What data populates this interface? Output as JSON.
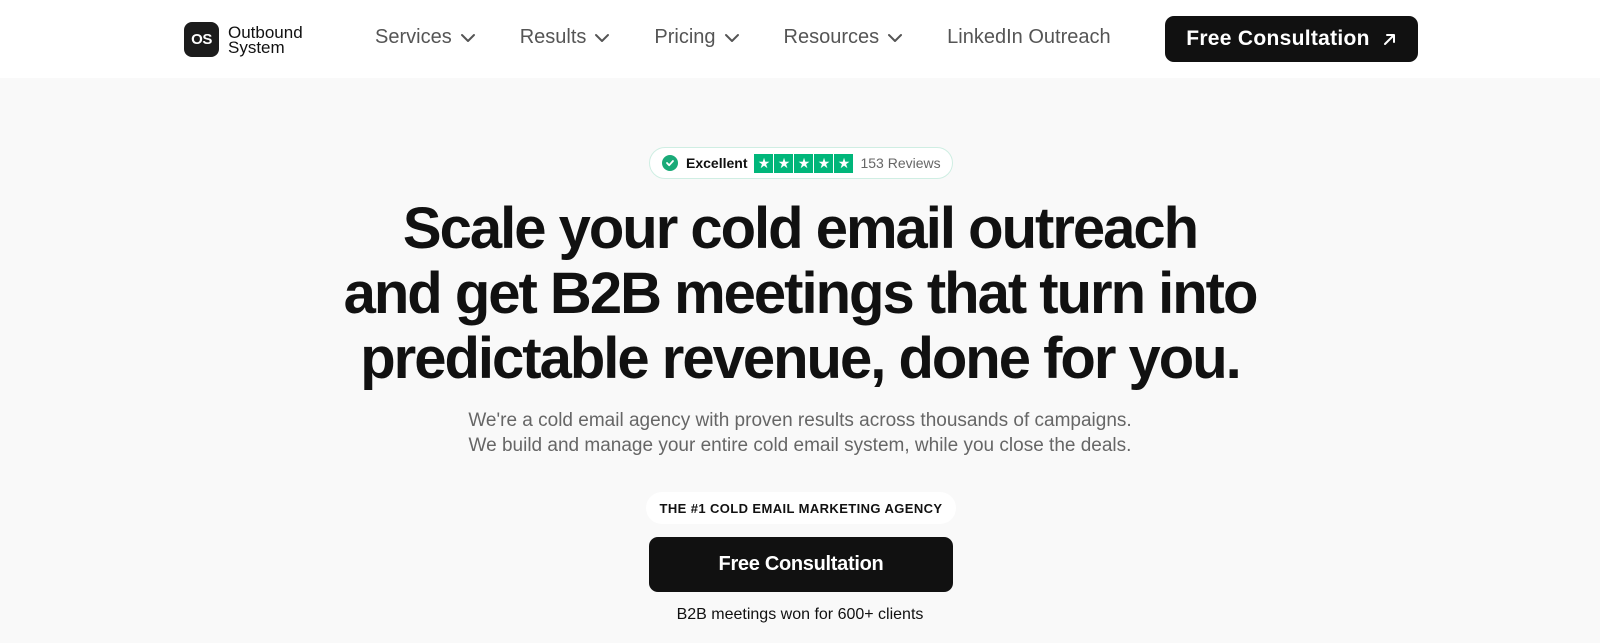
{
  "brand": {
    "mark": "OS",
    "line1": "Outbound",
    "line2": "System"
  },
  "nav": {
    "items": [
      {
        "label": "Services",
        "has_dropdown": true
      },
      {
        "label": "Results",
        "has_dropdown": true
      },
      {
        "label": "Pricing",
        "has_dropdown": true
      },
      {
        "label": "Resources",
        "has_dropdown": true
      },
      {
        "label": "LinkedIn Outreach",
        "has_dropdown": false
      }
    ],
    "cta_label": "Free Consultation"
  },
  "trust": {
    "rating_label": "Excellent",
    "stars": 5,
    "reviews": "153 Reviews",
    "star_color": "#00b67a"
  },
  "hero": {
    "title_line1": "Scale your cold email outreach",
    "title_line2": "and get B2B meetings that turn into",
    "title_line3": "predictable revenue, done for you.",
    "sub_line1": "We're a cold email agency with proven results across thousands of campaigns.",
    "sub_line2": "We build and manage your entire cold email system, while you close the deals.",
    "pill": "THE #1 COLD EMAIL MARKETING AGENCY",
    "cta_label": "Free Consultation",
    "note": "B2B meetings won for 600+ clients"
  },
  "icons": {
    "dropdown": "chevron-down-icon",
    "cta_arrow": "arrow-up-right-icon",
    "verified": "check-circle-icon",
    "star": "star-icon"
  }
}
